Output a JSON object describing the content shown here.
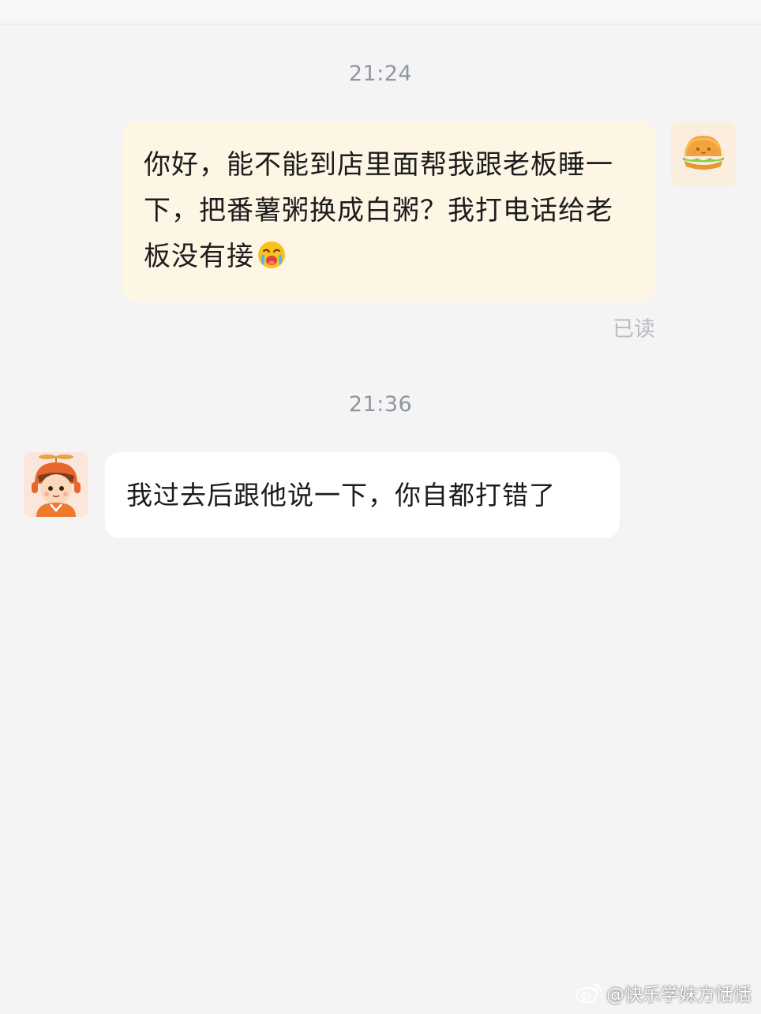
{
  "conversation": {
    "messages": [
      {
        "timestamp": "21:24",
        "direction": "outgoing",
        "text": "你好，能不能到店里面帮我跟老板睡一下，把番薯粥换成白粥？我打电话给老板没有接",
        "trailing_emoji": "crying-face-emoji",
        "status": "已读",
        "avatar": "burger-avatar"
      },
      {
        "timestamp": "21:36",
        "direction": "incoming",
        "text": "我过去后跟他说一下，你自都打错了",
        "avatar": "rider-avatar"
      }
    ]
  },
  "watermark": {
    "text": "@快乐学妹方恬恬",
    "icon": "weibo-icon"
  },
  "colors": {
    "background": "#f4f4f4",
    "outgoing_bubble": "#fdf6e5",
    "incoming_bubble": "#ffffff",
    "timestamp": "#8e96a0",
    "read_status": "#b9bcc2"
  }
}
